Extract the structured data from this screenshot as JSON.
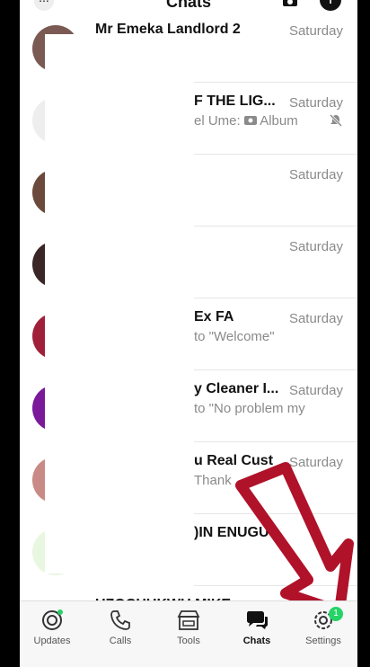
{
  "header": {
    "title": "Chats",
    "more_label": "..."
  },
  "chats": [
    {
      "name": "Mr Emeka Landlord 2",
      "time": "Saturday",
      "preview": ""
    },
    {
      "name": "F THE LIG...",
      "time": "Saturday",
      "preview": "el Ume: ",
      "preview_extra": "Album"
    },
    {
      "name": "",
      "time": "Saturday",
      "preview": ""
    },
    {
      "name": "",
      "time": "Saturday",
      "preview": ""
    },
    {
      "name": "Ex FA",
      "time": "Saturday",
      "preview": "to \"Welcome\""
    },
    {
      "name": "y Cleaner I...",
      "time": "Saturday",
      "preview": "to \"No problem my"
    },
    {
      "name": "u Real Cust",
      "time": "Saturday",
      "preview": "Thank"
    },
    {
      "name": ")IN ENUGU",
      "time": "",
      "preview": ""
    },
    {
      "name": "UZOCHUKWU MIKE",
      "time": "",
      "preview": ""
    }
  ],
  "tabs": [
    {
      "label": "Updates"
    },
    {
      "label": "Calls"
    },
    {
      "label": "Tools"
    },
    {
      "label": "Chats"
    },
    {
      "label": "Settings",
      "badge": "1"
    }
  ],
  "colors": {
    "accent": "#25d366",
    "arrow": "#b0122a"
  }
}
